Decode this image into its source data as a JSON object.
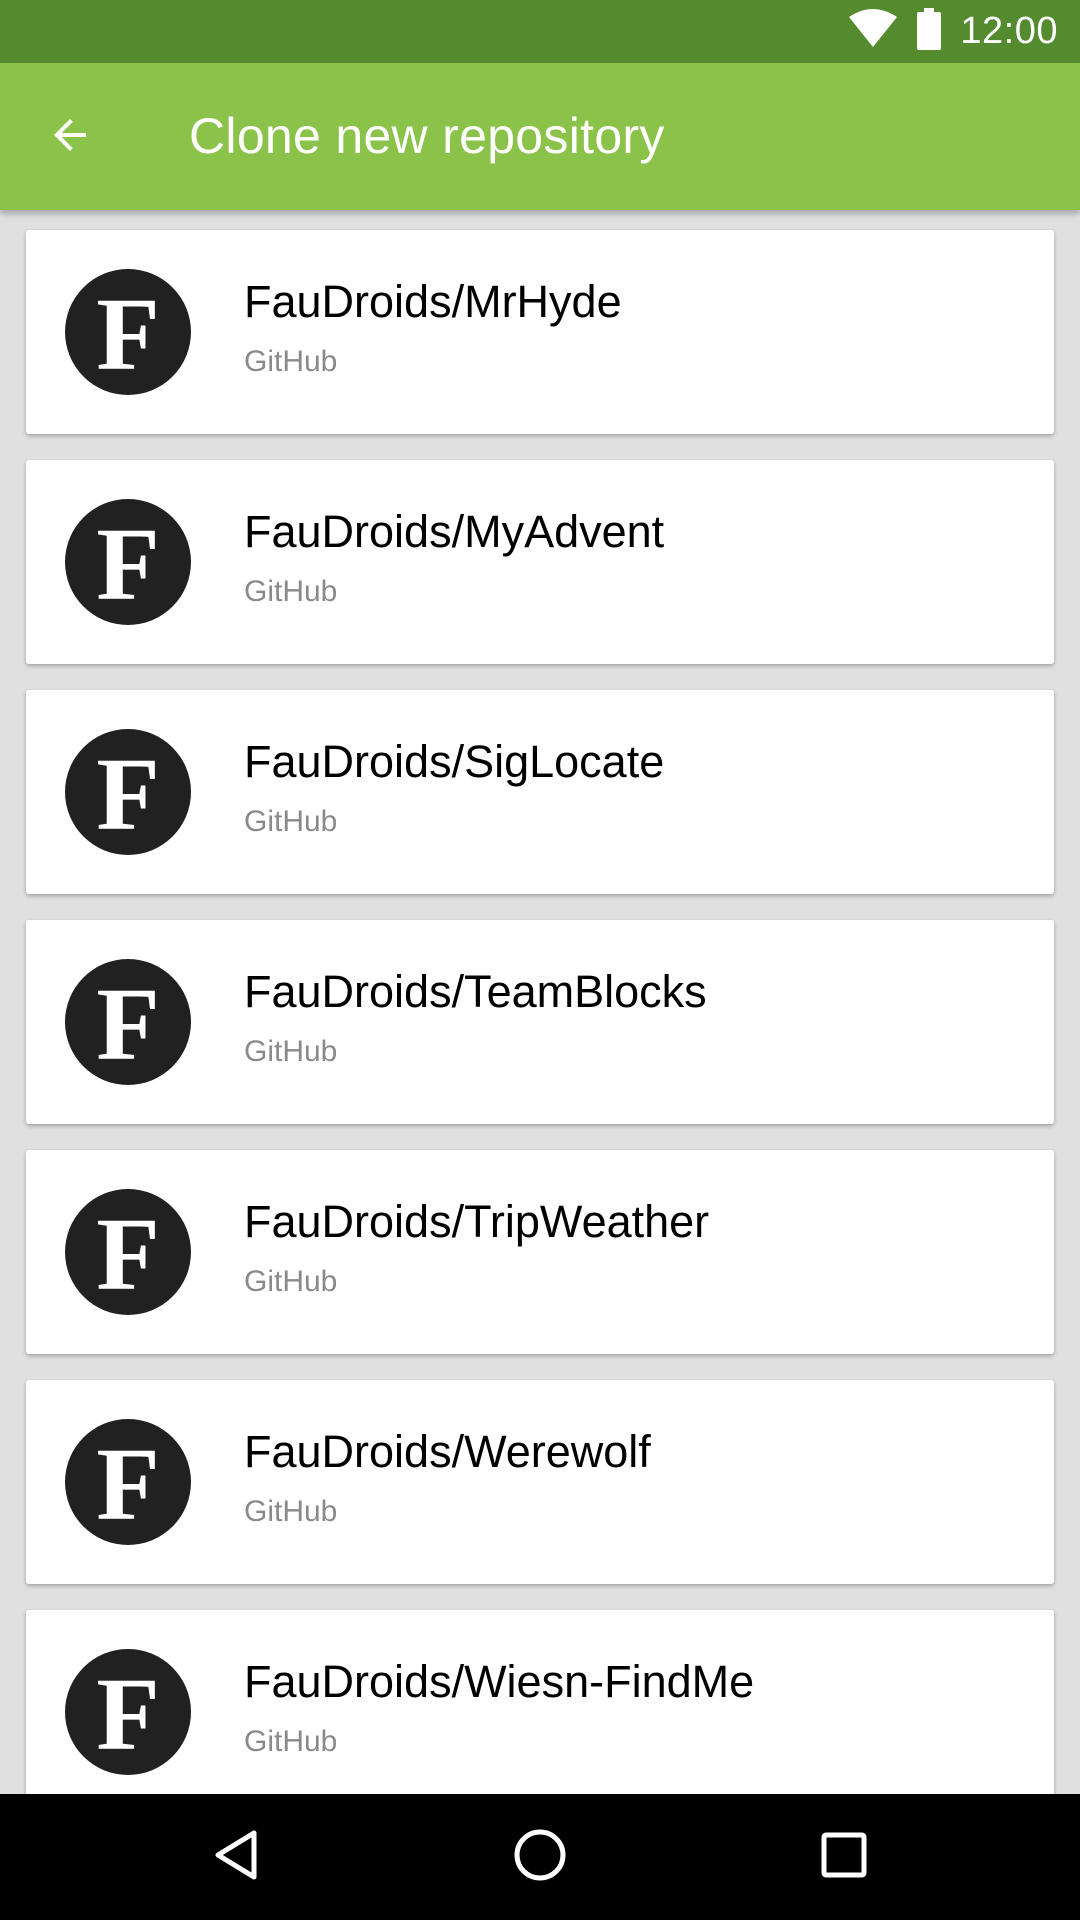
{
  "status_bar": {
    "time": "12:00",
    "icons": [
      "wifi-icon",
      "battery-icon"
    ],
    "background": "#558b2f"
  },
  "app_bar": {
    "title": "Clone new repository",
    "back_icon": "arrow-back-icon",
    "background": "#8bc34a"
  },
  "repositories": [
    {
      "avatar_letter": "F",
      "name": "FauDroids/MrHyde",
      "source": "GitHub"
    },
    {
      "avatar_letter": "F",
      "name": "FauDroids/MyAdvent",
      "source": "GitHub"
    },
    {
      "avatar_letter": "F",
      "name": "FauDroids/SigLocate",
      "source": "GitHub"
    },
    {
      "avatar_letter": "F",
      "name": "FauDroids/TeamBlocks",
      "source": "GitHub"
    },
    {
      "avatar_letter": "F",
      "name": "FauDroids/TripWeather",
      "source": "GitHub"
    },
    {
      "avatar_letter": "F",
      "name": "FauDroids/Werewolf",
      "source": "GitHub"
    },
    {
      "avatar_letter": "F",
      "name": "FauDroids/Wiesn-FindMe",
      "source": "GitHub"
    }
  ],
  "nav_bar": {
    "buttons": [
      "back-triangle-icon",
      "home-circle-icon",
      "recents-square-icon"
    ]
  }
}
